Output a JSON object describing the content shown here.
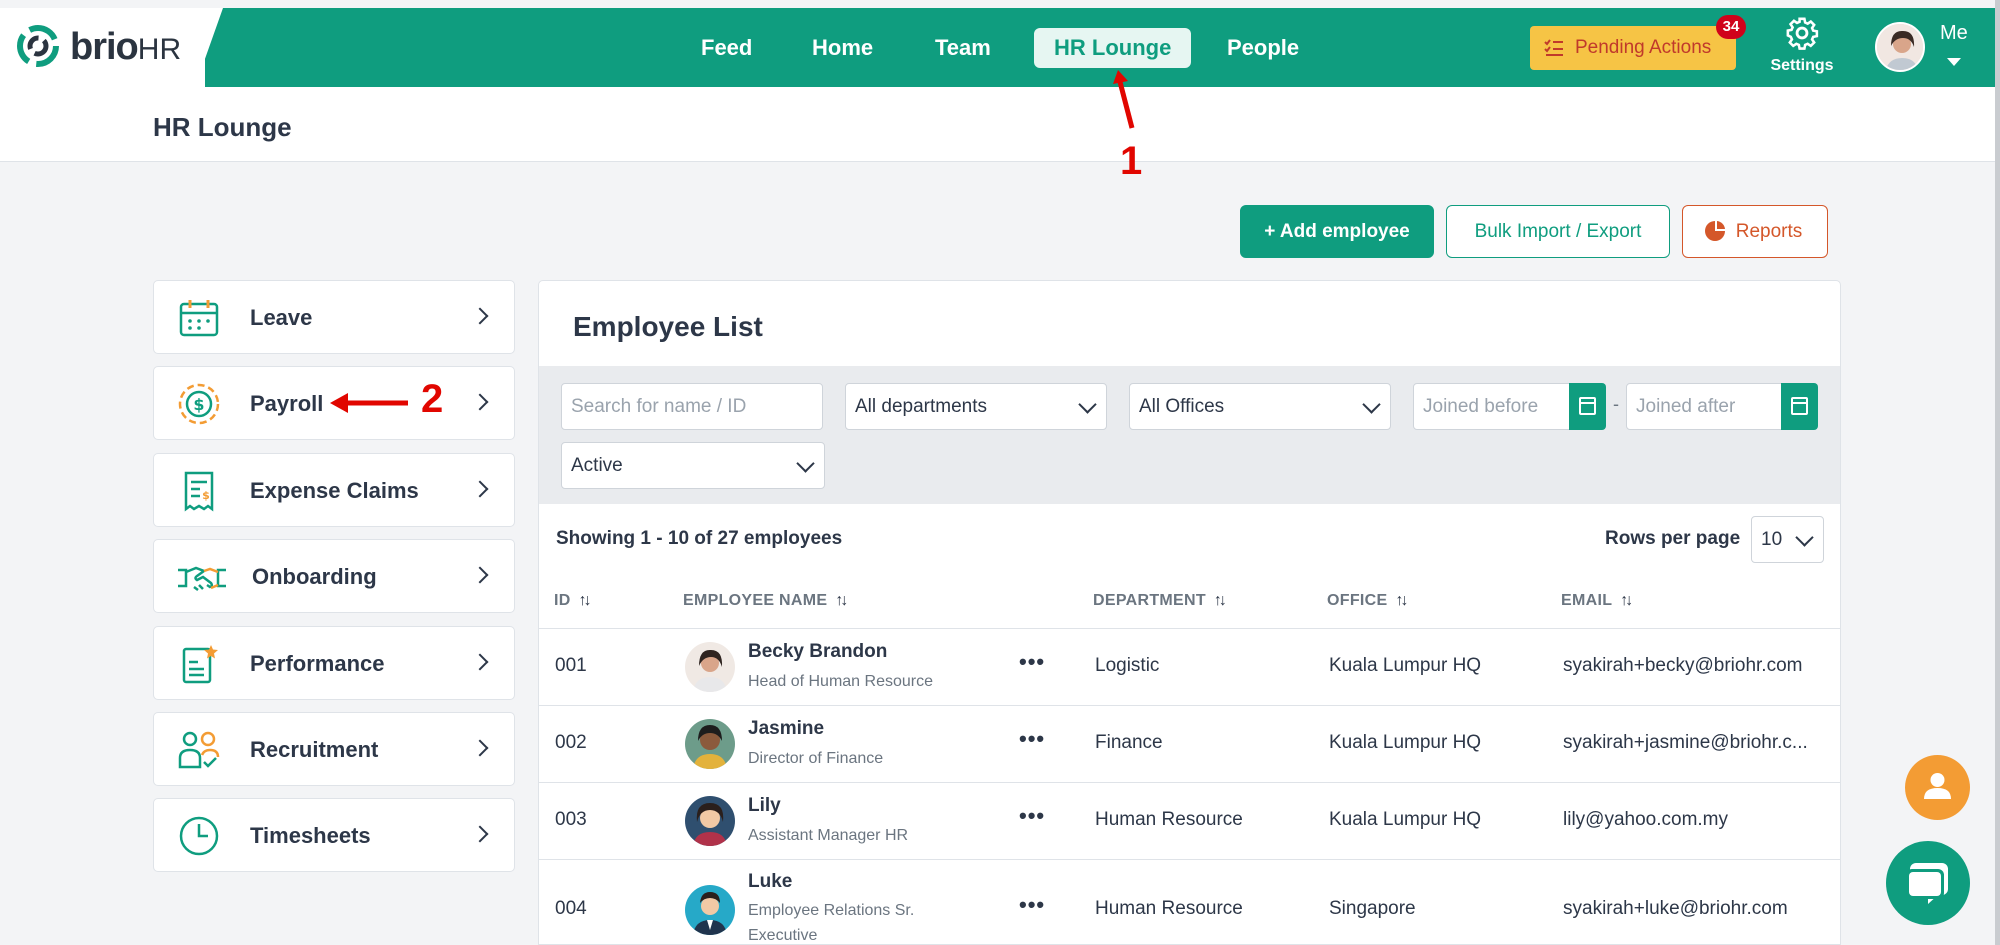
{
  "app": {
    "logo_text": "brio",
    "logo_suffix": "HR"
  },
  "nav": {
    "items": [
      {
        "label": "Feed",
        "active": false
      },
      {
        "label": "Home",
        "active": false
      },
      {
        "label": "Team",
        "active": false
      },
      {
        "label": "HR Lounge",
        "active": true
      },
      {
        "label": "People",
        "active": false
      }
    ],
    "pending_label": "Pending Actions",
    "pending_count": "34",
    "settings_label": "Settings",
    "me_label": "Me"
  },
  "page": {
    "title": "HR Lounge"
  },
  "annotations": {
    "step1": "1",
    "step2": "2"
  },
  "actions": {
    "add_employee": "+ Add employee",
    "bulk": "Bulk Import / Export",
    "reports": "Reports"
  },
  "sidebar": {
    "items": [
      {
        "label": "Leave",
        "icon": "calendar-icon"
      },
      {
        "label": "Payroll",
        "icon": "dollar-coin-icon"
      },
      {
        "label": "Expense Claims",
        "icon": "receipt-icon"
      },
      {
        "label": "Onboarding",
        "icon": "handshake-icon"
      },
      {
        "label": "Performance",
        "icon": "clipboard-star-icon"
      },
      {
        "label": "Recruitment",
        "icon": "people-check-icon"
      },
      {
        "label": "Timesheets",
        "icon": "clock-icon"
      }
    ]
  },
  "employee_list": {
    "title": "Employee List",
    "search_placeholder": "Search for name / ID",
    "department_filter": "All departments",
    "office_filter": "All Offices",
    "joined_before_placeholder": "Joined before",
    "joined_after_placeholder": "Joined after",
    "date_separator": "-",
    "status_filter": "Active",
    "showing": "Showing 1 - 10 of 27 employees",
    "rows_per_page_label": "Rows per page",
    "rows_per_page_value": "10",
    "columns": [
      "ID",
      "EMPLOYEE NAME",
      "DEPARTMENT",
      "OFFICE",
      "EMAIL"
    ],
    "rows": [
      {
        "id": "001",
        "name": "Becky Brandon",
        "title": "Head of Human Resource",
        "title2": "",
        "department": "Logistic",
        "office": "Kuala Lumpur HQ",
        "email": "syakirah+becky@briohr.com"
      },
      {
        "id": "002",
        "name": "Jasmine",
        "title": "Director of Finance",
        "title2": "",
        "department": "Finance",
        "office": "Kuala Lumpur HQ",
        "email": "syakirah+jasmine@briohr.c..."
      },
      {
        "id": "003",
        "name": "Lily",
        "title": "Assistant Manager HR",
        "title2": "",
        "department": "Human Resource",
        "office": "Kuala Lumpur HQ",
        "email": "lily@yahoo.com.my"
      },
      {
        "id": "004",
        "name": "Luke",
        "title": "Employee Relations Sr.",
        "title2": "Executive",
        "department": "Human Resource",
        "office": "Singapore",
        "email": "syakirah+luke@briohr.com"
      }
    ]
  },
  "colors": {
    "brand": "#0f9d7f",
    "pending": "#f6c445",
    "reports": "#d4572a",
    "annotation": "#e10600",
    "fab_user": "#f39c34"
  }
}
